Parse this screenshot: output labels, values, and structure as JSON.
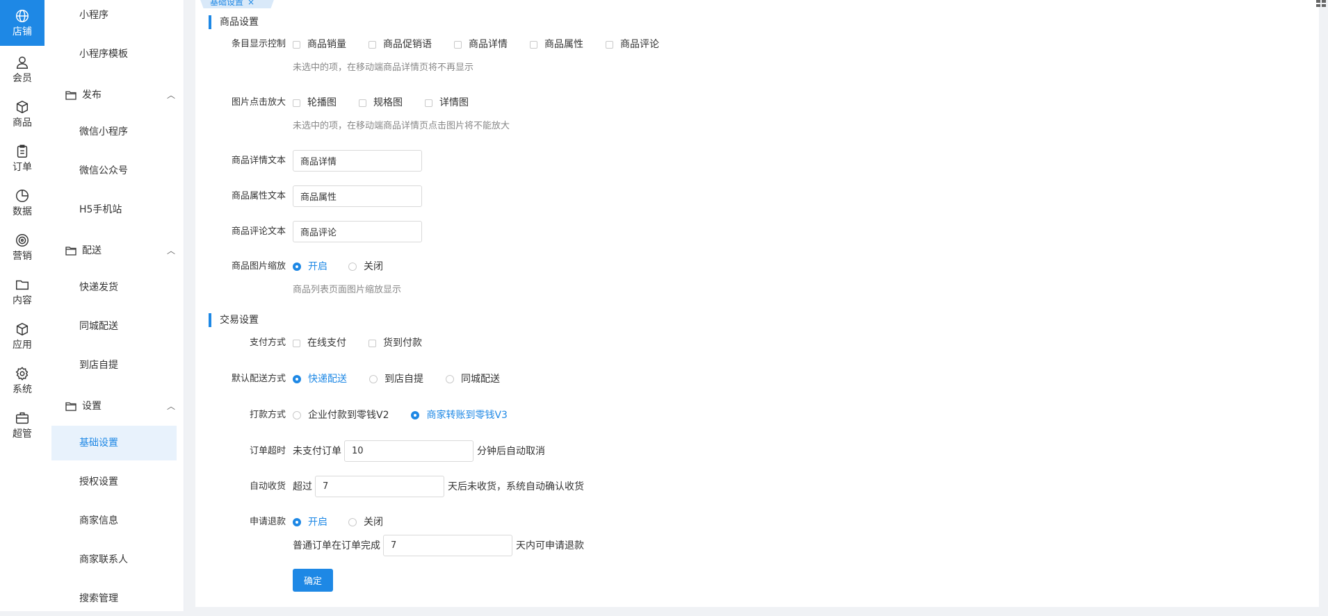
{
  "rail": {
    "items": [
      {
        "label": "店铺",
        "icon": "globe-icon",
        "active": true
      },
      {
        "label": "会员",
        "icon": "user-icon"
      },
      {
        "label": "商品",
        "icon": "box-icon"
      },
      {
        "label": "订单",
        "icon": "clipboard-icon"
      },
      {
        "label": "数据",
        "icon": "pie-chart-icon"
      },
      {
        "label": "营销",
        "icon": "target-icon"
      },
      {
        "label": "内容",
        "icon": "folder-icon"
      },
      {
        "label": "应用",
        "icon": "cube-icon"
      },
      {
        "label": "系统",
        "icon": "gear-icon"
      },
      {
        "label": "超管",
        "icon": "briefcase-icon"
      }
    ]
  },
  "menu": {
    "miniprogram": "小程序",
    "miniprogram_template": "小程序模板",
    "publish": {
      "title": "发布",
      "items": [
        "微信小程序",
        "微信公众号",
        "H5手机站"
      ]
    },
    "delivery": {
      "title": "配送",
      "items": [
        "快递发货",
        "同城配送",
        "到店自提"
      ]
    },
    "settings": {
      "title": "设置",
      "items": [
        "基础设置",
        "授权设置",
        "商家信息",
        "商家联系人",
        "搜索管理"
      ]
    }
  },
  "tab": {
    "label": "基础设置",
    "close": "×"
  },
  "accent_color": "#1e88e5",
  "goods": {
    "section_title": "商品设置",
    "display_control": {
      "label": "条目显示控制",
      "options": [
        "商品销量",
        "商品促销语",
        "商品详情",
        "商品属性",
        "商品评论"
      ],
      "hint": "未选中的项，在移动端商品详情页将不再显示"
    },
    "image_zoom": {
      "label": "图片点击放大",
      "options": [
        "轮播图",
        "规格图",
        "详情图"
      ],
      "hint": "未选中的项，在移动端商品详情页点击图片将不能放大"
    },
    "detail_text": {
      "label": "商品详情文本",
      "value": "商品详情"
    },
    "attr_text": {
      "label": "商品属性文本",
      "value": "商品属性"
    },
    "comment_text": {
      "label": "商品评论文本",
      "value": "商品评论"
    },
    "image_scale": {
      "label": "商品图片缩放",
      "on": "开启",
      "off": "关闭",
      "selected": "开启",
      "hint": "商品列表页面图片缩放显示"
    }
  },
  "trade": {
    "section_title": "交易设置",
    "payment": {
      "label": "支付方式",
      "options": [
        "在线支付",
        "货到付款"
      ]
    },
    "default_delivery": {
      "label": "默认配送方式",
      "options": [
        "快递配送",
        "到店自提",
        "同城配送"
      ],
      "selected": "快递配送"
    },
    "payout": {
      "label": "打款方式",
      "options": [
        "企业付款到零钱V2",
        "商家转账到零钱V3"
      ],
      "selected": "商家转账到零钱V3"
    },
    "order_timeout": {
      "label": "订单超时",
      "prefix": "未支付订单",
      "value": "10",
      "suffix": "分钟后自动取消"
    },
    "auto_receive": {
      "label": "自动收货",
      "prefix": "超过",
      "value": "7",
      "suffix": "天后未收货，系统自动确认收货"
    },
    "refund": {
      "label": "申请退款",
      "on": "开启",
      "off": "关闭",
      "selected": "开启",
      "prefix": "普通订单在订单完成",
      "value": "7",
      "suffix": "天内可申请退款"
    }
  },
  "submit_label": "确定"
}
